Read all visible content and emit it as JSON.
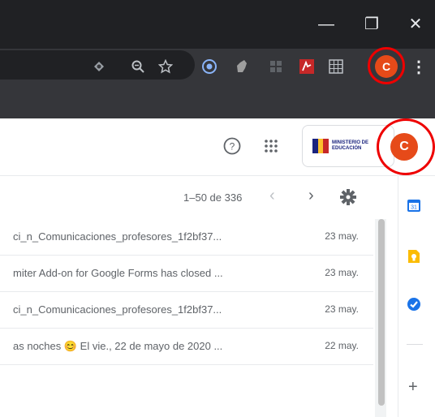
{
  "window": {
    "minimize_glyph": "—",
    "restore_glyph": "❐",
    "close_glyph": "✕"
  },
  "toolbar": {
    "extensions": [
      "eye-extension-icon",
      "zoom-icon",
      "star-icon",
      "circle-extension-icon",
      "hand-extension-icon",
      "grid-extension-icon",
      "pdf-extension-icon",
      "table-extension-icon"
    ],
    "profile_initial": "C",
    "menu_glyph": "⋮"
  },
  "header": {
    "help_glyph": "?",
    "apps_glyph": "⠿",
    "org_logo_text": "MINISTERIO DE EDUCACIÓN",
    "account_initial": "C"
  },
  "pager": {
    "range_text": "1–50 de 336",
    "prev_glyph": "‹",
    "next_glyph": "›"
  },
  "emails": [
    {
      "subject": "ci_n_Comunicaciones_profesores_1f2bf37...",
      "date": "23 may."
    },
    {
      "subject": "miter Add-on for Google Forms has closed ...",
      "date": "23 may."
    },
    {
      "subject": "ci_n_Comunicaciones_profesores_1f2bf37...",
      "date": "23 may."
    },
    {
      "subject": "as noches 😊 El vie., 22 de mayo de 2020 ...",
      "date": "22 may."
    }
  ],
  "side_panel": {
    "calendar_label": "31",
    "add_glyph": "+"
  },
  "colors": {
    "avatar": "#e64a19",
    "highlight_ring": "#ee0000"
  }
}
